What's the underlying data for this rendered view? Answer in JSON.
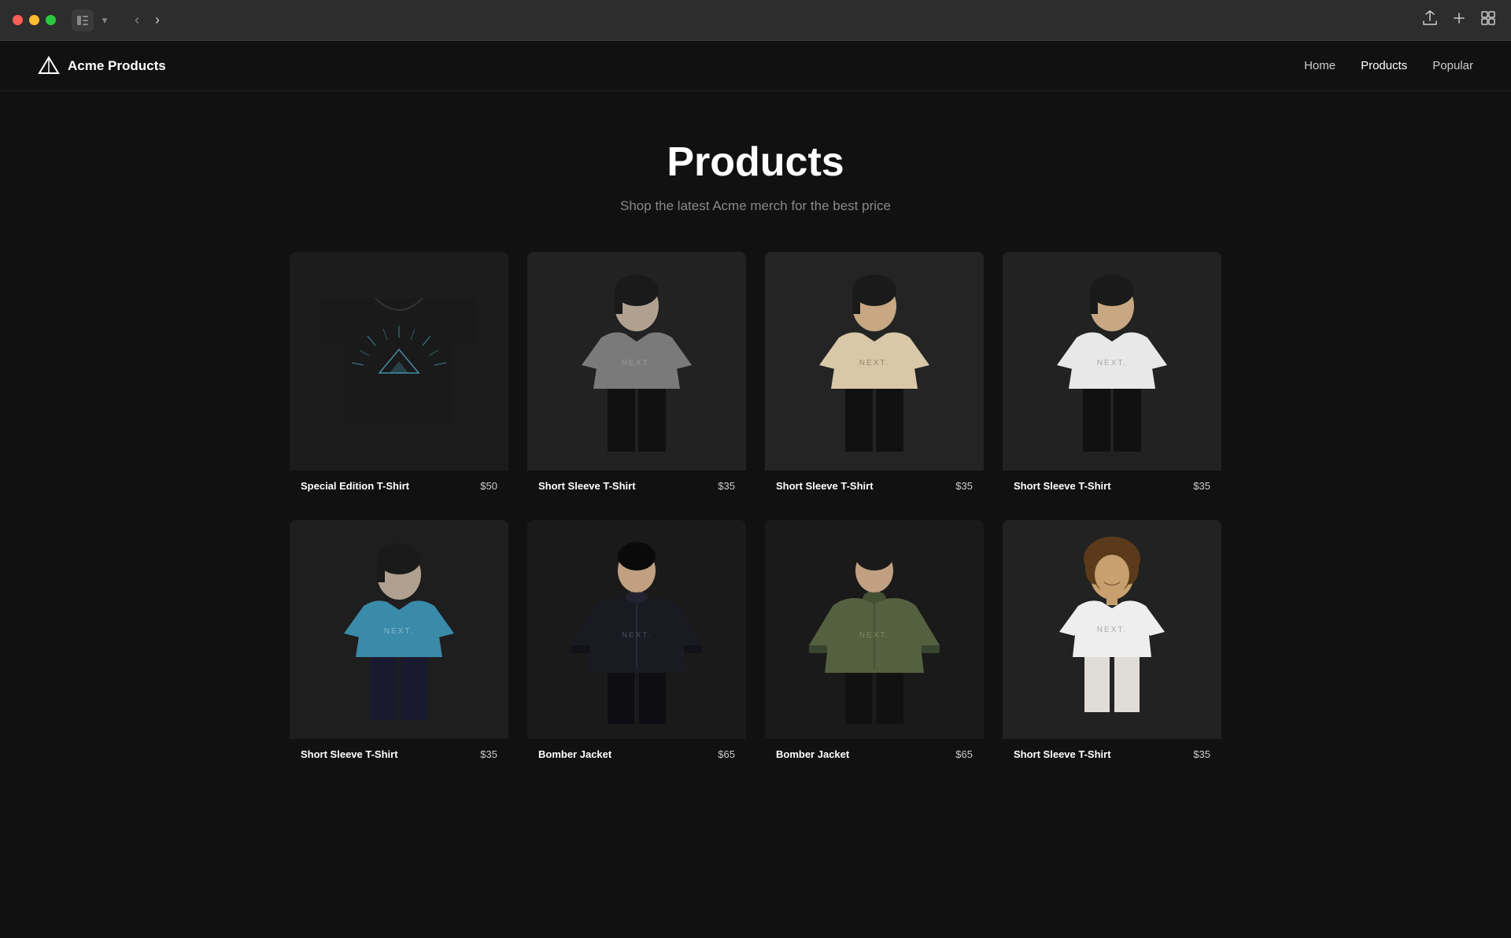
{
  "titlebar": {
    "traffic_lights": [
      {
        "name": "close",
        "color": "#ff5f57"
      },
      {
        "name": "minimize",
        "color": "#ffbd2e"
      },
      {
        "name": "maximize",
        "color": "#28ca41"
      }
    ],
    "sidebar_toggle_label": "⊞",
    "chevron_label": "⌄",
    "back_label": "‹",
    "forward_label": "›",
    "share_label": "↑",
    "new_tab_label": "+",
    "grid_label": "⊞"
  },
  "site": {
    "logo_alt": "Acme Logo",
    "name": "Acme Products",
    "nav": {
      "home_label": "Home",
      "products_label": "Products",
      "popular_label": "Popular"
    }
  },
  "hero": {
    "title": "Products",
    "subtitle": "Shop the latest Acme merch for the best price"
  },
  "products": [
    {
      "id": "special-edition",
      "name": "Special Edition T-Shirt",
      "price": "$50",
      "color_class": "color-black",
      "type": "special"
    },
    {
      "id": "short-sleeve-gray",
      "name": "Short Sleeve T-Shirt",
      "price": "$35",
      "color_class": "color-gray",
      "type": "tshirt"
    },
    {
      "id": "short-sleeve-cream",
      "name": "Short Sleeve T-Shirt",
      "price": "$35",
      "color_class": "color-cream",
      "type": "tshirt"
    },
    {
      "id": "short-sleeve-white",
      "name": "Short Sleeve T-Shirt",
      "price": "$35",
      "color_class": "color-white",
      "type": "tshirt"
    },
    {
      "id": "short-sleeve-cyan",
      "name": "Short Sleeve T-Shirt",
      "price": "$35",
      "color_class": "color-cyan",
      "type": "tshirt"
    },
    {
      "id": "bomber-black",
      "name": "Bomber Jacket",
      "price": "$65",
      "color_class": "color-navy-black",
      "type": "jacket"
    },
    {
      "id": "bomber-olive",
      "name": "Bomber Jacket",
      "price": "$65",
      "color_class": "color-olive",
      "type": "jacket"
    },
    {
      "id": "short-sleeve-white2",
      "name": "Short Sleeve T-Shirt",
      "price": "$35",
      "color_class": "color-white2",
      "type": "tshirt"
    }
  ]
}
